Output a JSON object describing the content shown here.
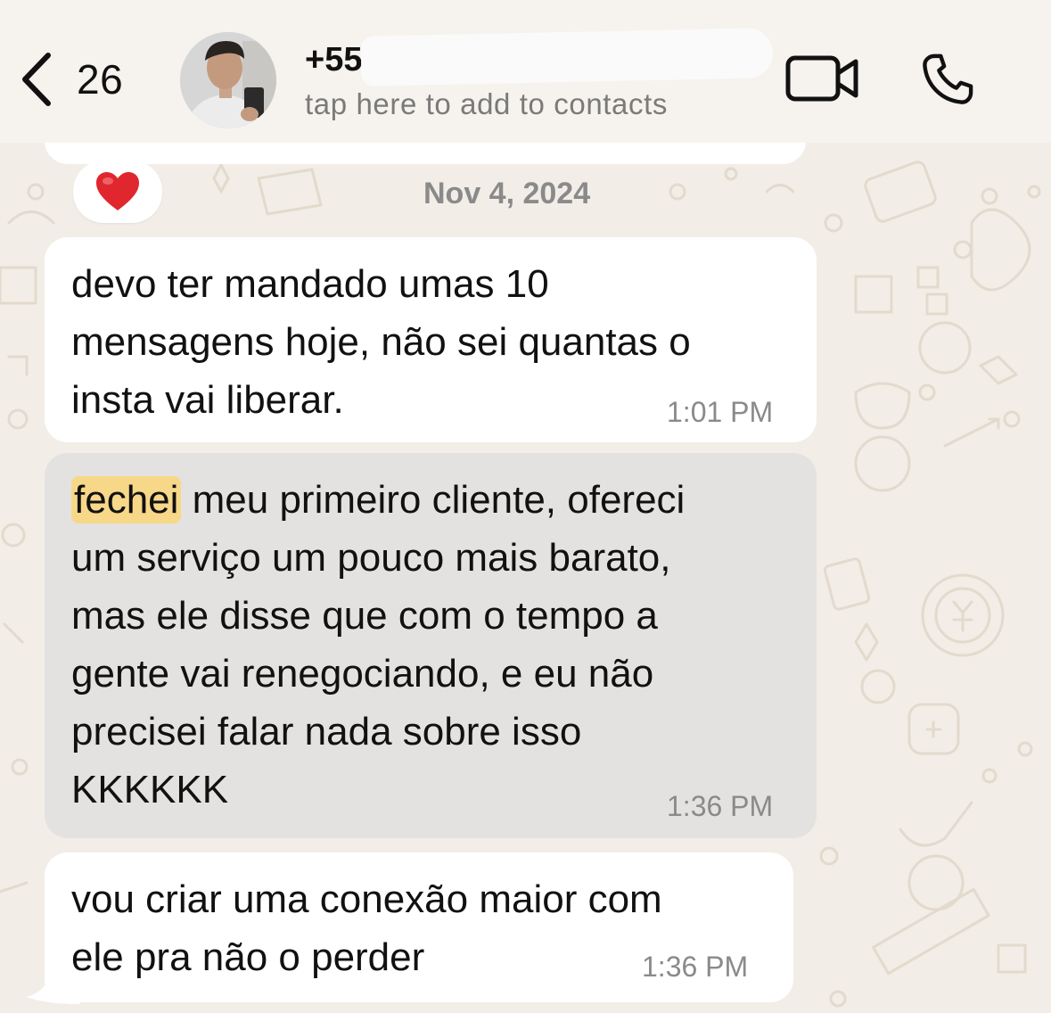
{
  "header": {
    "back_count": "26",
    "contact_name": "+55",
    "contact_subtitle": "tap here to add to contacts",
    "icons": {
      "back": "chevron-left-icon",
      "video": "video-camera-icon",
      "call": "phone-icon"
    }
  },
  "chat": {
    "date_chip": "Nov 4, 2024",
    "reaction": "❤️",
    "messages": [
      {
        "lines": [
          "devo ter mandado umas 10",
          "mensagens hoje, não sei quantas o",
          "insta vai liberar."
        ],
        "time": "1:01 PM"
      },
      {
        "highlight": "fechei",
        "lines": [
          " meu primeiro cliente, ofereci",
          "um serviço um pouco mais barato,",
          "mas ele disse que com o tempo a",
          "gente vai renegociando, e eu não",
          "precisei falar nada sobre isso",
          "KKKKKK"
        ],
        "time": "1:36 PM",
        "selected": true
      },
      {
        "lines": [
          "vou criar uma conexão maior com",
          "ele pra não o perder"
        ],
        "time": "1:36 PM"
      }
    ]
  },
  "colors": {
    "wallpaper": "#f2ede6",
    "bubble": "#ffffff",
    "bubble_selected": "#e4e2e0",
    "search_highlight": "#f7d889",
    "timestamp": "#8a8a8a"
  }
}
